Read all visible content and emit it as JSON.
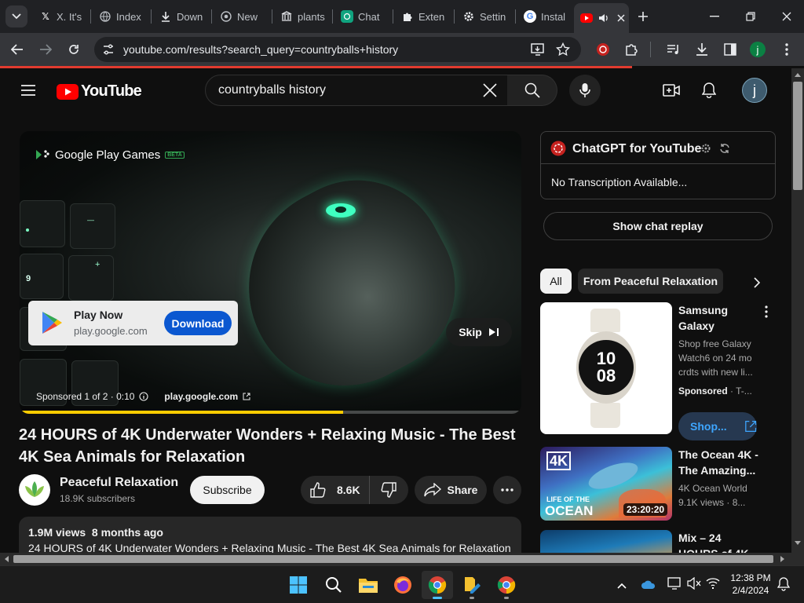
{
  "browser": {
    "tabs": [
      {
        "label": "X. It's",
        "icon": "x-logo-icon"
      },
      {
        "label": "Index",
        "icon": "globe-icon"
      },
      {
        "label": "Down",
        "icon": "download-icon"
      },
      {
        "label": "New",
        "icon": "chromium-icon"
      },
      {
        "label": "plants",
        "icon": "bank-icon"
      },
      {
        "label": "Chat",
        "icon": "chatgpt-icon"
      },
      {
        "label": "Exten",
        "icon": "puzzle-icon"
      },
      {
        "label": "Settin",
        "icon": "gear-icon"
      },
      {
        "label": "Instal",
        "icon": "google-icon"
      },
      {
        "label": "",
        "icon": "youtube-icon"
      }
    ],
    "url": "youtube.com/results?search_query=countryballs+history",
    "profile_initial": "j"
  },
  "youtube": {
    "logo_text": "YouTube",
    "search_value": "countryballs history",
    "avatar_initial": "j"
  },
  "ad": {
    "brand": "Google Play Games",
    "brand_badge": "BETA",
    "card_title": "Play Now",
    "card_domain": "play.google.com",
    "download_label": "Download",
    "skip_label": "Skip",
    "sponsored_text": "Sponsored 1 of 2 · 0:10",
    "domain_link": "play.google.com",
    "progress": 0.645
  },
  "video": {
    "title": "24 HOURS of 4K Underwater Wonders + Relaxing Music - The Best 4K Sea Animals for Relaxation",
    "channel": "Peaceful Relaxation",
    "subscribers": "18.9K subscribers",
    "subscribe_label": "Subscribe",
    "likes": "8.6K",
    "share_label": "Share",
    "views_line": "1.9M views  8 months ago",
    "description_first": "24 HOURS of 4K Underwater Wonders + Relaxing Music - The Best 4K Sea Animals for Relaxation"
  },
  "sidebar": {
    "chatgpt_title": "ChatGPT for YouTube",
    "transcription": "No Transcription Available...",
    "chat_replay": "Show chat replay",
    "chips": [
      "All",
      "From Peaceful Relaxation"
    ],
    "recs": [
      {
        "title": "Samsung Galaxy Watch...",
        "line1": "Shop free Galaxy",
        "line2": "Watch6 on 24 mo",
        "line3": "crdts with new li...",
        "sponsor": "Sponsored",
        "sponsor_extra": " · T-...",
        "shop_label": "Shop..."
      },
      {
        "title": "The Ocean 4K - The Amazing...",
        "channel": "4K Ocean World",
        "meta": "9.1K views · 8...",
        "duration": "23:20:20",
        "thumb_top": "4K",
        "thumb_life": "LIFE OF THE",
        "thumb_ocean": "OCEAN"
      },
      {
        "title": "Mix – 24 HOURS of 4K..."
      }
    ],
    "watch_digits": [
      "10",
      "08"
    ]
  },
  "taskbar": {
    "time": "12:38 PM",
    "date": "2/4/2024"
  }
}
